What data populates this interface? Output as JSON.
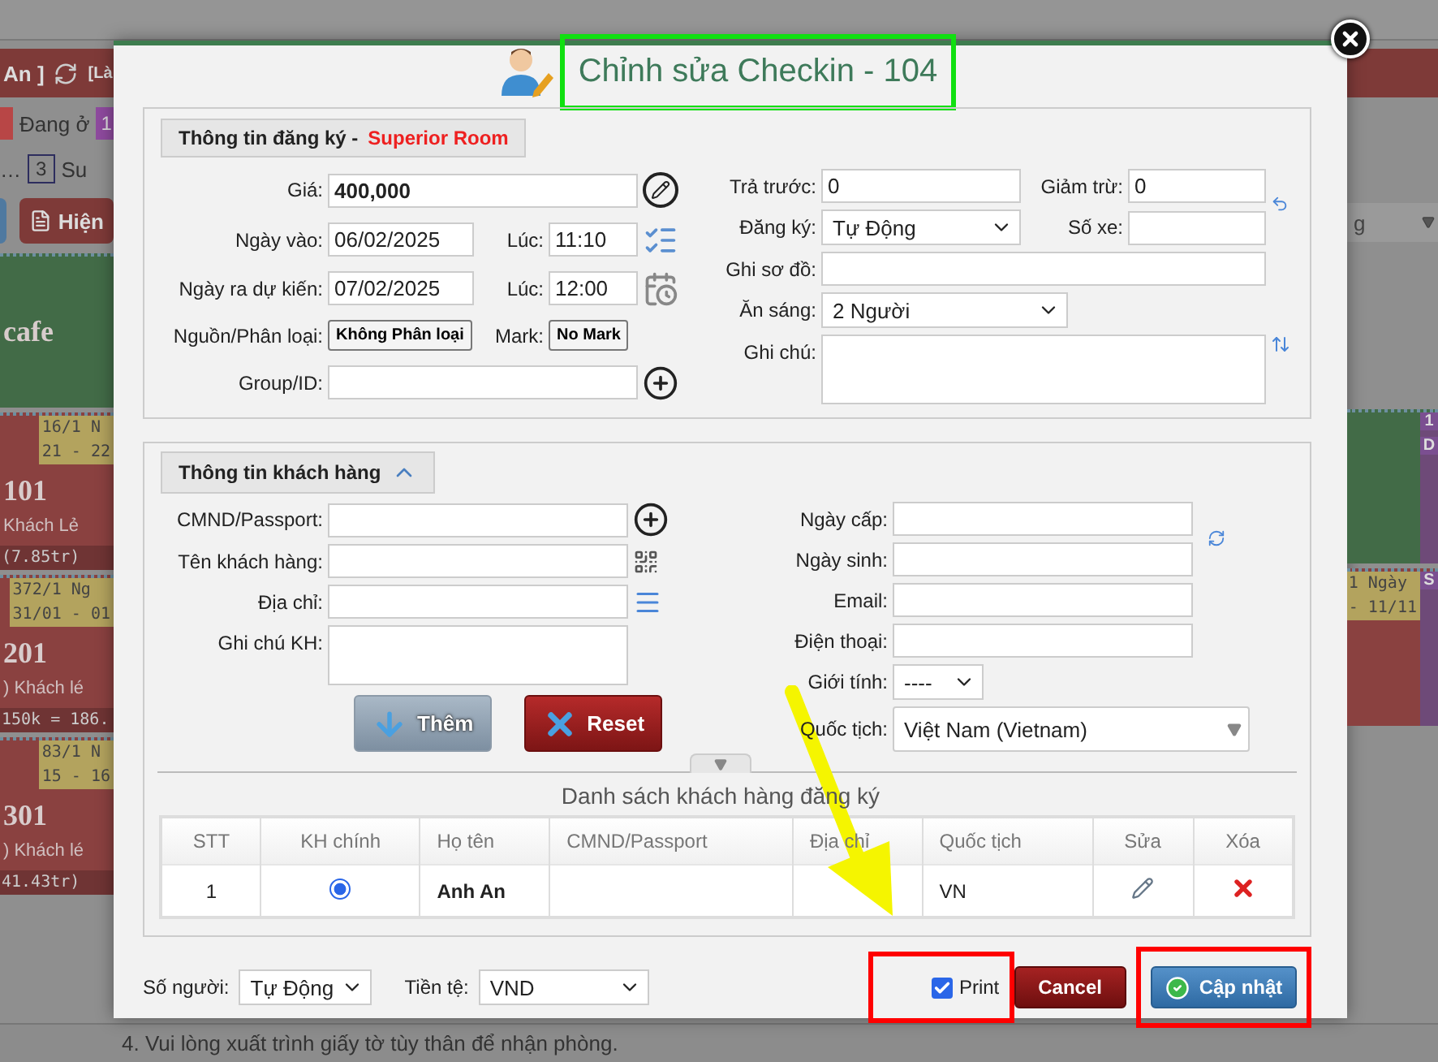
{
  "board": {
    "top_button": "An ]",
    "reload_label": "[Là",
    "legend": [
      {
        "label": "Đang ở",
        "color": "#b84646"
      },
      {
        "count": "1",
        "color": "#8e4a9e"
      }
    ],
    "legend_row2": {
      "ellipsis": "…",
      "count": "3",
      "label": "Su"
    },
    "view_button": "Hiện",
    "rooms_left": [
      {
        "kind": "cafe",
        "name": "cafe"
      },
      {
        "kind": "room",
        "tag": [
          "16/1 N",
          "21 - 22"
        ],
        "name": "101",
        "guest": "Khách Lẻ",
        "total": "(7.85tr)"
      },
      {
        "kind": "room",
        "tag": [
          "372/1 Ng",
          "31/01 - 01"
        ],
        "name": "201",
        "guest": ") Khách lé",
        "total": "150k = 186."
      },
      {
        "kind": "room",
        "tag": [
          "83/1 N",
          "15 - 16"
        ],
        "name": "301",
        "guest": ") Khách lé",
        "total": "41.43tr)"
      }
    ],
    "right_dropdown": "g",
    "rooms_right": [
      {
        "kind": "cafe",
        "badges": [
          "1",
          "D"
        ]
      },
      {
        "kind": "room",
        "tag": [
          "1 Ngày",
          "- 11/11"
        ],
        "badges": [
          "S"
        ]
      }
    ],
    "notice": "4. Vui lòng xuất trình giấy tờ tùy thân để nhận phòng."
  },
  "dialog": {
    "title": "Chỉnh sửa Checkin - 104",
    "registration": {
      "legend": "Thông tin đăng ký -",
      "room_type": "Superior Room",
      "price": {
        "label": "Giá:",
        "value": "400,000"
      },
      "checkin": {
        "label": "Ngày vào:",
        "date": "06/02/2025",
        "time_label": "Lúc:",
        "time": "11:10"
      },
      "checkout": {
        "label": "Ngày ra dự kiến:",
        "date": "07/02/2025",
        "time_label": "Lúc:",
        "time": "12:00"
      },
      "source": {
        "label": "Nguồn/Phân loại:",
        "value": "Không Phân loại"
      },
      "mark": {
        "label": "Mark:",
        "value": "No Mark"
      },
      "group": {
        "label": "Group/ID:"
      },
      "prepaid": {
        "label": "Trả trước:",
        "value": "0"
      },
      "discount": {
        "label": "Giảm trừ:",
        "value": "0"
      },
      "registration_type": {
        "label": "Đăng ký:",
        "value": "Tự Động"
      },
      "plate": {
        "label": "Số xe:"
      },
      "map_note": {
        "label": "Ghi sơ đồ:"
      },
      "breakfast": {
        "label": "Ăn sáng:",
        "value": "2 Người"
      },
      "note": {
        "label": "Ghi chú:"
      }
    },
    "customer": {
      "legend": "Thông tin khách hàng",
      "expanded": true,
      "id_number": {
        "label": "CMND/Passport:"
      },
      "name": {
        "label": "Tên khách hàng:"
      },
      "address": {
        "label": "Địa chỉ:"
      },
      "note": {
        "label": "Ghi chú KH:"
      },
      "issue_date": {
        "label": "Ngày cấp:"
      },
      "birth_date": {
        "label": "Ngày sinh:"
      },
      "email": {
        "label": "Email:"
      },
      "phone": {
        "label": "Điện thoại:"
      },
      "gender": {
        "label": "Giới tính:",
        "value": "----"
      },
      "nationality": {
        "label": "Quốc tịch:",
        "value": "Việt Nam (Vietnam)"
      },
      "add_button": "Thêm",
      "reset_button": "Reset"
    },
    "guests": {
      "caption": "Danh sách khách hàng đăng ký",
      "columns": [
        "STT",
        "KH chính",
        "Họ tên",
        "CMND/Passport",
        "Địa chỉ",
        "Quốc tịch",
        "Sửa",
        "Xóa"
      ],
      "rows": [
        {
          "stt": "1",
          "selected": true,
          "name": "Anh An",
          "id_number": "",
          "address": "",
          "nationality": "VN"
        }
      ]
    },
    "footer": {
      "people": {
        "label": "Số người:",
        "value": "Tự Động"
      },
      "currency": {
        "label": "Tiền tệ:",
        "value": "VND"
      },
      "print": {
        "label": "Print",
        "checked": true
      },
      "cancel": "Cancel",
      "update": "Cập nhật"
    }
  }
}
